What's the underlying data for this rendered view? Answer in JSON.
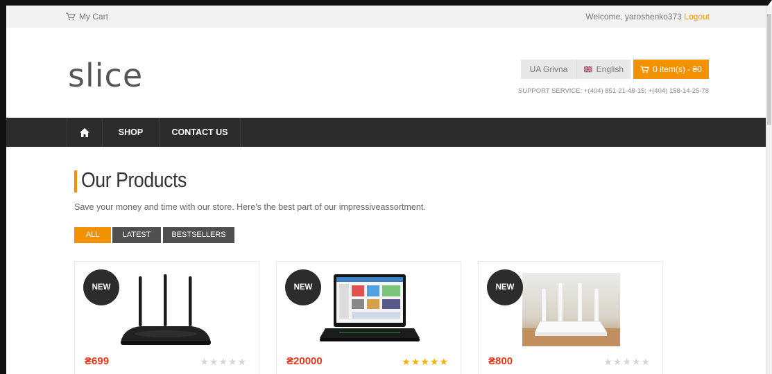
{
  "topbar": {
    "cart_label": "My Cart",
    "welcome_text": "Welcome, yaroshenko373",
    "logout_label": "Logout"
  },
  "header": {
    "logo_text": "slice",
    "currency_label": "UA Grivna",
    "language_label": "English",
    "cart_button_label": "0 item(s) - ₴0",
    "support_text": "SUPPORT SERVICE: +(404) 851-21-48-15; +(404) 158-14-25-78"
  },
  "nav": {
    "items": [
      {
        "label": "SHOP"
      },
      {
        "label": "CONTACT US"
      }
    ]
  },
  "section": {
    "title": "Our Products",
    "subtitle": "Save your money and time with our store. Here's the best part of our impressiveassortment."
  },
  "filters": [
    {
      "label": "ALL",
      "active": true
    },
    {
      "label": "LATEST",
      "active": false
    },
    {
      "label": "BESTSELLERS",
      "active": false
    }
  ],
  "products": [
    {
      "badge": "NEW",
      "price": "₴699",
      "rating": 0,
      "image": "wifi-router-icon"
    },
    {
      "badge": "NEW",
      "price": "₴20000",
      "rating": 5,
      "image": "laptop-icon"
    },
    {
      "badge": "NEW",
      "price": "₴800",
      "rating": 0,
      "image": "router-photo-icon"
    }
  ],
  "colors": {
    "accent": "#f39200",
    "nav_bg": "#2c2c2c",
    "price": "#e03a1e",
    "star_on": "#f5b300",
    "star_off": "#d6d6d6"
  }
}
